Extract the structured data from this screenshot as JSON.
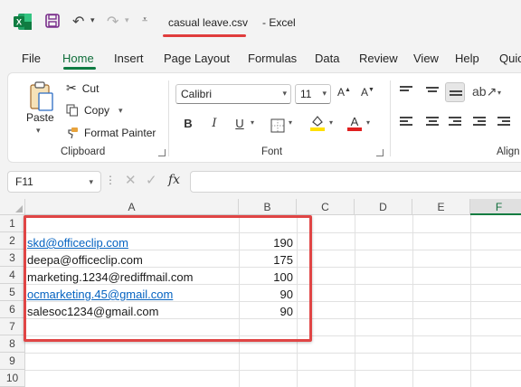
{
  "window": {
    "file_name": "casual leave.csv",
    "app_name": "-  Excel"
  },
  "menu": {
    "tabs": [
      "File",
      "Home",
      "Insert",
      "Page Layout",
      "Formulas",
      "Data",
      "Review",
      "View",
      "Help",
      "Quic"
    ],
    "active": "Home"
  },
  "ribbon": {
    "clipboard": {
      "label": "Clipboard",
      "paste": "Paste",
      "cut": "Cut",
      "copy": "Copy",
      "format_painter": "Format Painter"
    },
    "font": {
      "label": "Font",
      "name": "Calibri",
      "size": "11"
    },
    "alignment": {
      "label": "Align"
    },
    "colors": {
      "highlight": "#ffe000",
      "font_color": "#e02020",
      "accent": "#107c41"
    }
  },
  "formula_bar": {
    "name_box": "F11",
    "fx_label": "fx",
    "formula": ""
  },
  "sheet": {
    "columns": [
      "A",
      "B",
      "C",
      "D",
      "E",
      "F"
    ],
    "selected_column": "F",
    "rows": [
      "1",
      "2",
      "3",
      "4",
      "5",
      "6",
      "7",
      "8",
      "9",
      "10"
    ],
    "data": [
      {
        "email": "skd@officeclip.com",
        "value": "190",
        "is_link": true
      },
      {
        "email": "deepa@officeclip.com",
        "value": "175",
        "is_link": false
      },
      {
        "email": "marketing.1234@rediffmail.com",
        "value": "100",
        "is_link": false
      },
      {
        "email": "ocmarketing.45@gmail.com",
        "value": "90",
        "is_link": true
      },
      {
        "email": "salesoc1234@gmail.com",
        "value": "90",
        "is_link": false
      }
    ]
  }
}
